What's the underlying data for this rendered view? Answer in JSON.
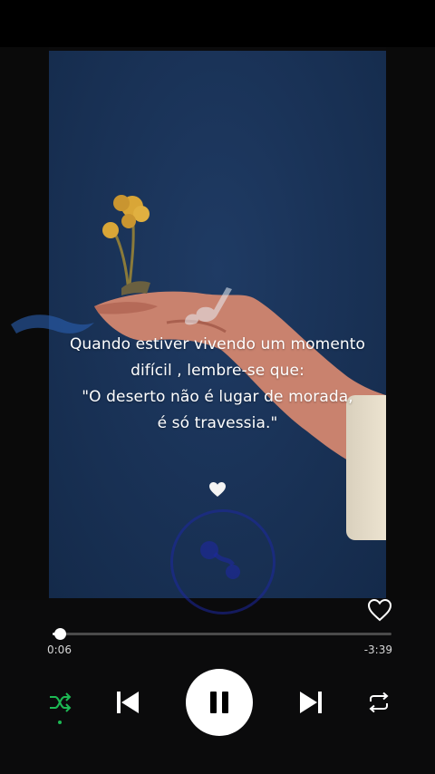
{
  "artwork": {
    "quote_lines": [
      "Quando estiver vivendo um momento",
      "difícil , lembre-se que:",
      "\"O deserto não é lugar de morada,",
      "é só travessia.\""
    ]
  },
  "player": {
    "progress_fraction": 0.022,
    "time_elapsed": "0:06",
    "time_remaining": "-3:39",
    "liked": false,
    "shuffle_on": true,
    "is_playing": true
  },
  "icons": {
    "like": "heart-outline-icon",
    "shuffle": "shuffle-icon",
    "previous": "skip-previous-icon",
    "play_pause": "pause-icon",
    "next": "skip-next-icon",
    "repeat": "repeat-icon"
  },
  "colors": {
    "accent": "#1db954",
    "background": "#0b0b0c",
    "artwork_bg": "#1a3358"
  }
}
